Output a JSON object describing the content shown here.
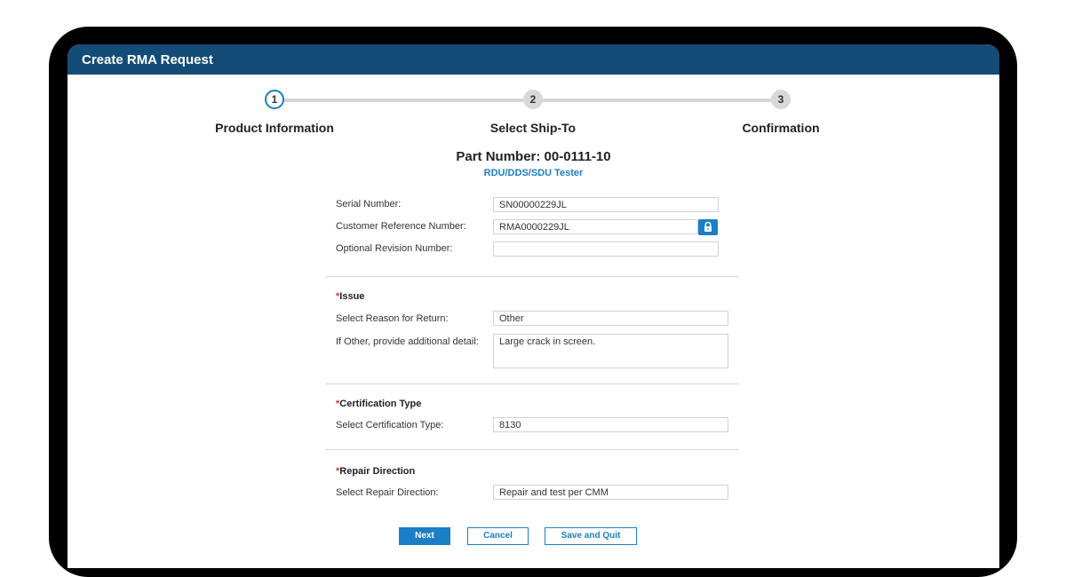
{
  "header": {
    "title": "Create RMA Request"
  },
  "steps": [
    {
      "number": "1",
      "label": "Product Information"
    },
    {
      "number": "2",
      "label": "Select Ship-To"
    },
    {
      "number": "3",
      "label": "Confirmation"
    }
  ],
  "part": {
    "number_label": "Part Number: 00-0111-10",
    "description": "RDU/DDS/SDU Tester"
  },
  "product_fields": {
    "serial_label": "Serial Number:",
    "serial_value": "SN00000229JL",
    "customer_ref_label": "Customer Reference Number:",
    "customer_ref_value": "RMA0000229JL",
    "revision_label": "Optional Revision Number:",
    "revision_value": ""
  },
  "issue": {
    "required_mark": "*",
    "heading": "Issue",
    "reason_label": "Select Reason for Return:",
    "reason_value": "Other",
    "detail_label": "If Other, provide additional detail:",
    "detail_value": "Large crack in screen."
  },
  "certification": {
    "required_mark": "*",
    "heading": "Certification Type",
    "type_label": "Select Certification Type:",
    "type_value": "8130"
  },
  "repair": {
    "required_mark": "*",
    "heading": "Repair Direction",
    "direction_label": "Select Repair Direction:",
    "direction_value": "Repair and test per CMM"
  },
  "buttons": {
    "next": "Next",
    "cancel": "Cancel",
    "save_quit": "Save and Quit"
  },
  "colors": {
    "header_bg": "#134c77",
    "accent": "#1a7fc4",
    "required": "#d0342c"
  },
  "icons": {
    "lock": "lock-icon"
  }
}
